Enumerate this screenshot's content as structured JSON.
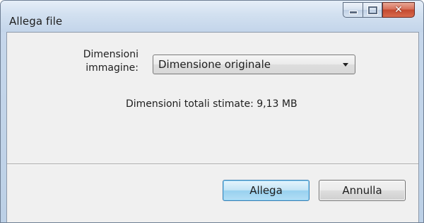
{
  "window": {
    "title": "Allega file",
    "controls": {
      "minimize": "minimize-icon",
      "maximize": "maximize-icon",
      "close": "close-icon"
    }
  },
  "form": {
    "image_size_label_line1": "Dimensioni",
    "image_size_label_line2": "immagine:",
    "image_size_selected": "Dimensione originale",
    "estimated_total": "Dimensioni totali stimate: 9,13 MB"
  },
  "buttons": {
    "attach_label": "Allega",
    "cancel_label": "Annulla"
  },
  "colors": {
    "titlebar": "#d2e0f0",
    "client_background": "#f0f0f0",
    "close_button": "#c44a30",
    "primary_button_border": "#3c7fb1"
  }
}
